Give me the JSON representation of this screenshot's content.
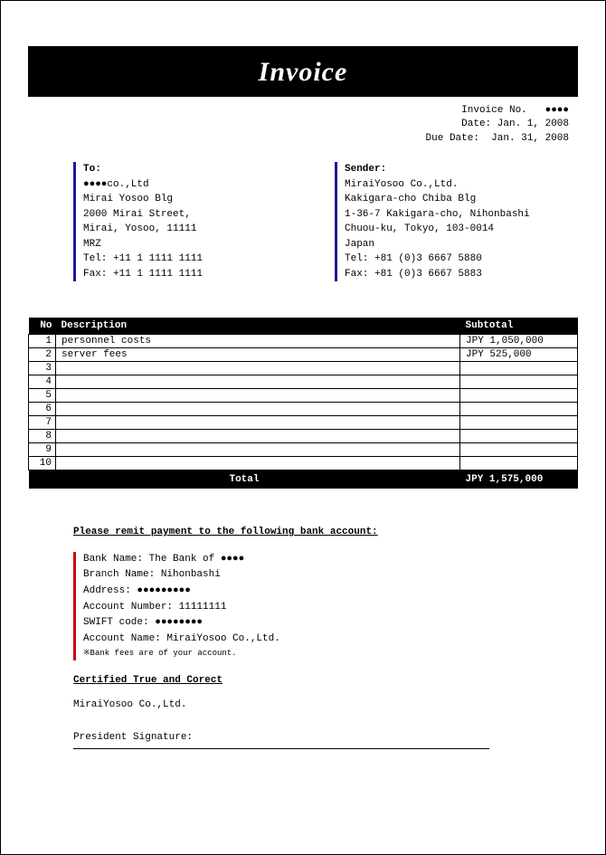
{
  "title": "Invoice",
  "meta": {
    "invoice_no_label": "Invoice No.",
    "invoice_no": "●●●●",
    "date_label": "Date:",
    "date": "Jan. 1, 2008",
    "due_label": "Due Date:",
    "due": "Jan. 31, 2008"
  },
  "to": {
    "heading": "To:",
    "name": "●●●●co.,Ltd",
    "line1": "Mirai Yosoo Blg",
    "line2": "2000 Mirai Street,",
    "line3": "Mirai, Yosoo, 11111",
    "country": "MRZ",
    "tel": "Tel: +11 1 1111 1111",
    "fax": "Fax: +11 1 1111 1111"
  },
  "sender": {
    "heading": "Sender:",
    "name": "MiraiYosoo Co.,Ltd.",
    "line1": "Kakigara-cho Chiba Blg",
    "line2": "1-36-7 Kakigara-cho, Nihonbashi",
    "line3": "Chuou-ku, Tokyo, 103-0014",
    "country": "Japan",
    "tel": "Tel: +81 (0)3 6667 5880",
    "fax": "Fax: +81 (0)3 6667 5883"
  },
  "columns": {
    "no": "No",
    "desc": "Description",
    "sub": "Subtotal"
  },
  "rows": [
    {
      "no": "1",
      "desc": "personnel costs",
      "sub": "JPY 1,050,000"
    },
    {
      "no": "2",
      "desc": "server fees",
      "sub": "JPY 525,000"
    },
    {
      "no": "3",
      "desc": "",
      "sub": ""
    },
    {
      "no": "4",
      "desc": "",
      "sub": ""
    },
    {
      "no": "5",
      "desc": "",
      "sub": ""
    },
    {
      "no": "6",
      "desc": "",
      "sub": ""
    },
    {
      "no": "7",
      "desc": "",
      "sub": ""
    },
    {
      "no": "8",
      "desc": "",
      "sub": ""
    },
    {
      "no": "9",
      "desc": "",
      "sub": ""
    },
    {
      "no": "10",
      "desc": "",
      "sub": ""
    }
  ],
  "total": {
    "label": "Total",
    "value": "JPY 1,575,000"
  },
  "payment": {
    "heading": "Please remit payment to the following bank account:",
    "bank_name": "Bank Name: The Bank of ●●●●",
    "branch": "Branch Name: Nihonbashi",
    "address": "Address: ●●●●●●●●●",
    "account_number": "Account Number: 11111111",
    "swift": "SWIFT code: ●●●●●●●●",
    "account_name": "Account Name: MiraiYosoo Co.,Ltd.",
    "note": "※Bank fees are of your account."
  },
  "cert": {
    "heading": "Certified True and Corect",
    "company": "MiraiYosoo Co.,Ltd.",
    "sig_label": "President Signature:"
  }
}
